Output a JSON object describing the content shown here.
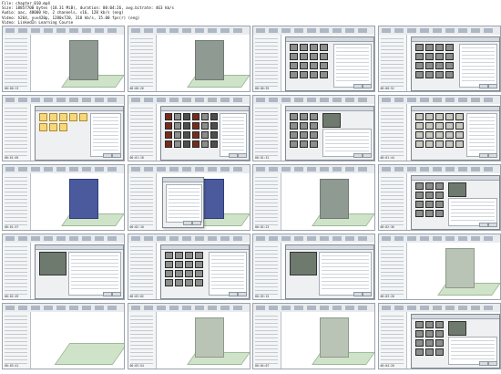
{
  "header": {
    "line1": "File: chapter_010.mp4",
    "line2": "Size: 18857700 bytes (18.31 MiB), duration: 00:04:26, avg.bitrate: 463 kb/s",
    "line3": "Audio: aac, 48000 Hz, 2 channels, s16, 128 kb/s (eng)",
    "line4": "Video: h264, yuv420p, 1280x720, 318 kb/s, 15.00 fps(r) (eng)",
    "line5": "Video: LinkedIn Learning Course"
  },
  "thumbnails": [
    {
      "scene": "wall",
      "ts": "00:00:13"
    },
    {
      "scene": "wall",
      "ts": "00:00:26"
    },
    {
      "scene": "dialog-grid",
      "ts": "00:00:39"
    },
    {
      "scene": "dialog-grid",
      "ts": "00:00:52"
    },
    {
      "scene": "dialog-icons",
      "ts": "00:01:05"
    },
    {
      "scene": "dialog-mat",
      "ts": "00:01:18"
    },
    {
      "scene": "dialog-preview",
      "ts": "00:01:31"
    },
    {
      "scene": "dialog-light",
      "ts": "00:01:44"
    },
    {
      "scene": "wall-blue",
      "ts": "00:01:57"
    },
    {
      "scene": "form-wall-blue",
      "ts": "00:02:10"
    },
    {
      "scene": "wall",
      "ts": "00:02:23"
    },
    {
      "scene": "dialog-preview",
      "ts": "00:02:36"
    },
    {
      "scene": "dialog-form",
      "ts": "00:02:49"
    },
    {
      "scene": "dialog-grid",
      "ts": "00:03:02"
    },
    {
      "scene": "dialog-form",
      "ts": "00:03:15"
    },
    {
      "scene": "wall-light",
      "ts": "00:03:28"
    },
    {
      "scene": "floor",
      "ts": "00:03:41"
    },
    {
      "scene": "wall-light",
      "ts": "00:03:54"
    },
    {
      "scene": "wall-light",
      "ts": "00:04:07"
    },
    {
      "scene": "dialog-preview",
      "ts": "00:04:20"
    }
  ]
}
